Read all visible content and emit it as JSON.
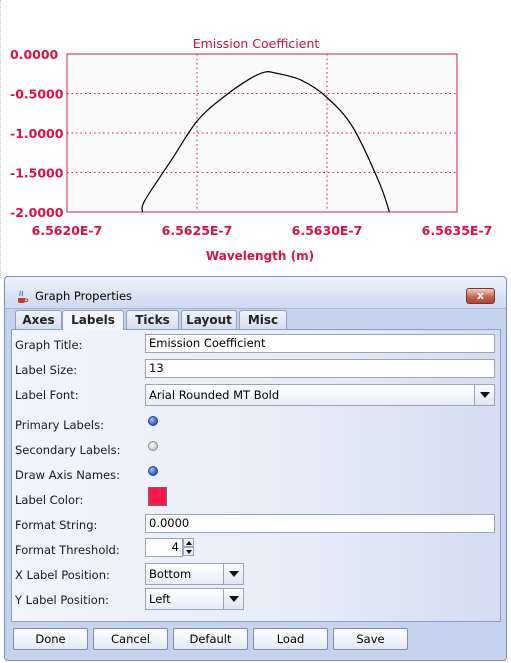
{
  "chart_data": {
    "type": "line",
    "title": "Emission Coefficient",
    "xlabel": "Wavelength (m)",
    "ylabel": "",
    "xlim": [
      6.562e-07,
      6.5635e-07
    ],
    "ylim": [
      -2.0,
      0.0
    ],
    "x_ticks": [
      6.562e-07,
      6.5625e-07,
      6.563e-07,
      6.5635e-07
    ],
    "x_tick_labels": [
      "6.5620E-7",
      "6.5625E-7",
      "6.5630E-7",
      "6.5635E-7"
    ],
    "y_ticks": [
      0.0,
      -0.5,
      -1.0,
      -1.5,
      -2.0
    ],
    "y_tick_labels": [
      "0.0000",
      "-0.5000",
      "-1.0000",
      "-1.5000",
      "-2.0000"
    ],
    "grid": true,
    "series": [
      {
        "x": [
          6.56229e-07,
          6.5623e-07,
          6.5624e-07,
          6.5625e-07,
          6.5626e-07,
          6.5627e-07,
          6.56276e-07,
          6.5628e-07,
          6.5629e-07,
          6.563e-07,
          6.5631e-07,
          6.5632e-07,
          6.56324e-07
        ],
        "y": [
          -2.0,
          -1.85,
          -1.35,
          -0.85,
          -0.55,
          -0.32,
          -0.23,
          -0.24,
          -0.33,
          -0.55,
          -0.93,
          -1.62,
          -2.0
        ]
      }
    ],
    "colors": {
      "line": "#000000",
      "text": "#dd1144",
      "frame": "#cc2255",
      "grid": "#cc2255",
      "plot_bg": "#fafafa"
    }
  },
  "dialog": {
    "title": "Graph Properties",
    "close_label": "x",
    "tabs": [
      {
        "label": "Axes"
      },
      {
        "label": "Labels",
        "active": true
      },
      {
        "label": "Ticks"
      },
      {
        "label": "Layout"
      },
      {
        "label": "Misc"
      }
    ],
    "fields": {
      "graph_title": {
        "label": "Graph Title:",
        "value": "Emission Coefficient"
      },
      "label_size": {
        "label": "Label Size:",
        "value": "13"
      },
      "label_font": {
        "label": "Label Font:",
        "value": "Arial Rounded MT Bold"
      },
      "primary_labels": {
        "label": "Primary Labels:",
        "checked": true
      },
      "secondary_labels": {
        "label": "Secondary Labels:",
        "checked": false
      },
      "draw_axis_names": {
        "label": "Draw Axis Names:",
        "checked": true
      },
      "label_color": {
        "label": "Label Color:",
        "color": "#ff1848"
      },
      "format_string": {
        "label": "Format String:",
        "value": "0.0000"
      },
      "format_threshold": {
        "label": "Format Threshold:",
        "value": "4"
      },
      "x_label_position": {
        "label": "X Label Position:",
        "value": "Bottom"
      },
      "y_label_position": {
        "label": "Y Label Position:",
        "value": "Left"
      }
    },
    "buttons": {
      "done": "Done",
      "cancel": "Cancel",
      "default": "Default",
      "load": "Load",
      "save": "Save"
    }
  }
}
